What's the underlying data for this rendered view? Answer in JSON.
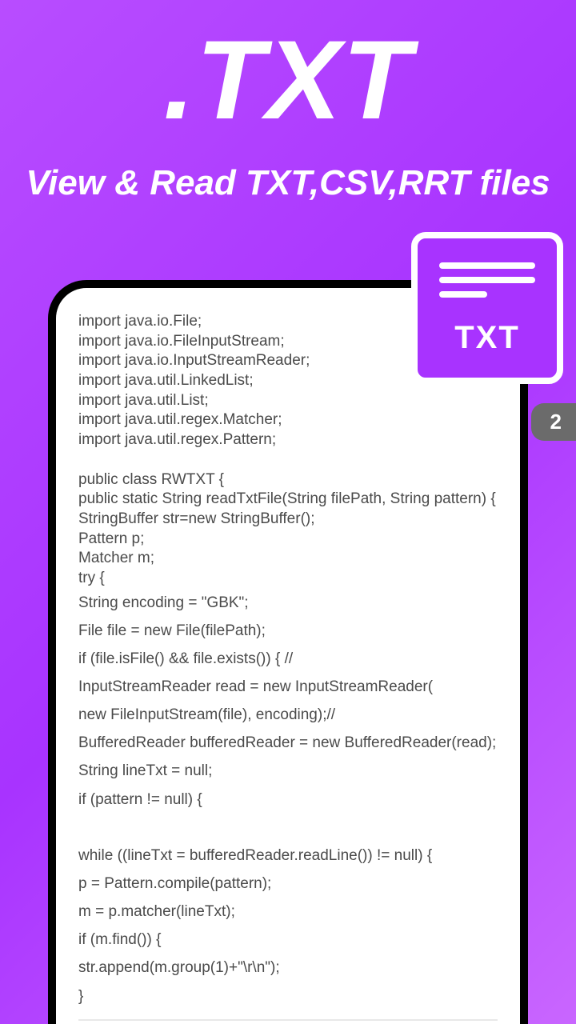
{
  "hero": {
    "title": ".TXT",
    "subtitle": "View & Read TXT,CSV,RRT files"
  },
  "badge": {
    "label": "TXT"
  },
  "page_indicator": "2",
  "code": {
    "block1": "import java.io.File;\nimport java.io.FileInputStream;\nimport java.io.InputStreamReader;\nimport java.util.LinkedList;\nimport java.util.List;\nimport java.util.regex.Matcher;\nimport java.util.regex.Pattern;\n\npublic class RWTXT {\npublic static String readTxtFile(String filePath, String pattern) {\nStringBuffer str=new StringBuffer();\nPattern p;\nMatcher m;\ntry {",
    "block2": "String encoding = \"GBK\";\nFile file = new File(filePath);\nif (file.isFile() && file.exists()) { //\nInputStreamReader read = new InputStreamReader(\nnew FileInputStream(file), encoding);//\nBufferedReader bufferedReader = new BufferedReader(read);\nString lineTxt = null;\nif (pattern != null) {\n\nwhile ((lineTxt = bufferedReader.readLine()) != null) {\np = Pattern.compile(pattern);\nm = p.matcher(lineTxt);\nif (m.find()) {\nstr.append(m.group(1)+\"\\r\\n\");\n}"
  }
}
